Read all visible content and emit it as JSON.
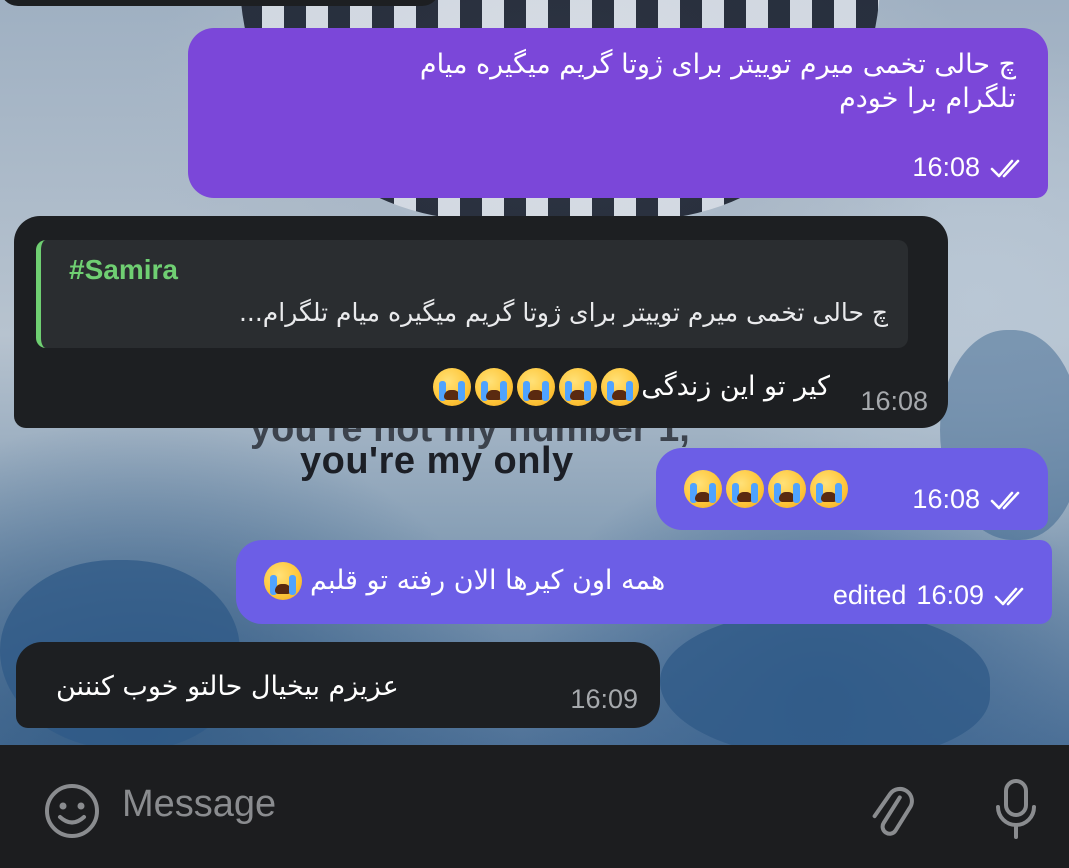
{
  "messages": [
    {
      "id": "m1",
      "direction": "outgoing",
      "text_line1": "چ حالی تخمی میرم توییتر برای ژوتا گریم میگیره میام",
      "text_line2": "تلگرام برا خودم",
      "time": "16:08",
      "status": "read"
    },
    {
      "id": "m2",
      "direction": "incoming",
      "reply_name": "#Samira",
      "reply_text": "چ حالی تخمی میرم توییتر برای ژوتا گریم میگیره میام تلگرام...",
      "text": "کیر تو این زندگی",
      "emoji_count": 5,
      "time": "16:08"
    },
    {
      "id": "m3",
      "direction": "outgoing",
      "emoji_count": 4,
      "time": "16:08",
      "status": "read"
    },
    {
      "id": "m4",
      "direction": "outgoing",
      "text": "همه اون کیرها الان رفته تو قلبم",
      "emoji_count": 1,
      "edited_label": "edited",
      "time": "16:09",
      "status": "read"
    },
    {
      "id": "m5",
      "direction": "incoming",
      "text": "عزیزم بیخیال حالتو  خوب کنننن",
      "time": "16:09"
    }
  ],
  "wallpaper": {
    "line1": "you're not my number 1,",
    "line2": "you're my only"
  },
  "composer": {
    "placeholder": "Message"
  },
  "icons": {
    "emoji": "smiley-icon",
    "attach": "paperclip-icon",
    "mic": "microphone-icon",
    "read": "double-check-icon"
  },
  "colors": {
    "outgoing": "#7b47d9",
    "outgoing_alt": "#6c5ee6",
    "incoming": "#1d1f22",
    "reply_accent": "#6fcf72",
    "composer_bg": "#1c1d1f"
  }
}
